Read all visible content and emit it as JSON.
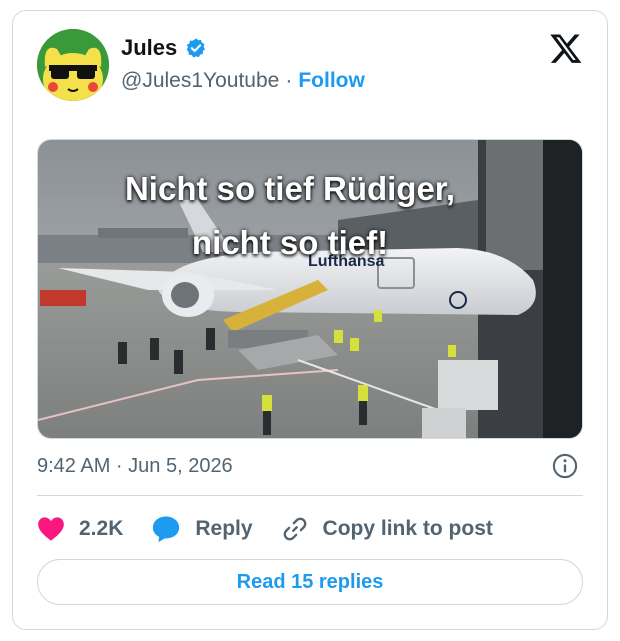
{
  "author": {
    "display_name": "Jules",
    "handle": "@Jules1Youtube",
    "separator": "·",
    "follow_label": "Follow",
    "verified": true
  },
  "media": {
    "caption_line1": "Nicht so tief Rüdiger,",
    "caption_line2": "nicht so tief!",
    "airline_text": "Lufthansa"
  },
  "meta": {
    "timestamp": "9:42 AM · Jun 5, 2026"
  },
  "actions": {
    "likes_count": "2.2K",
    "reply_label": "Reply",
    "copy_link_label": "Copy link to post"
  },
  "replies_button_label": "Read 15 replies",
  "colors": {
    "accent": "#1d9bf0",
    "like": "#f91880",
    "text_secondary": "#536471",
    "border": "#cfd9de"
  },
  "icons": {
    "verified": "verified-badge-icon",
    "brand": "x-logo-icon",
    "info": "info-icon",
    "like": "heart-icon",
    "reply": "speech-bubble-icon",
    "copy": "link-icon"
  }
}
